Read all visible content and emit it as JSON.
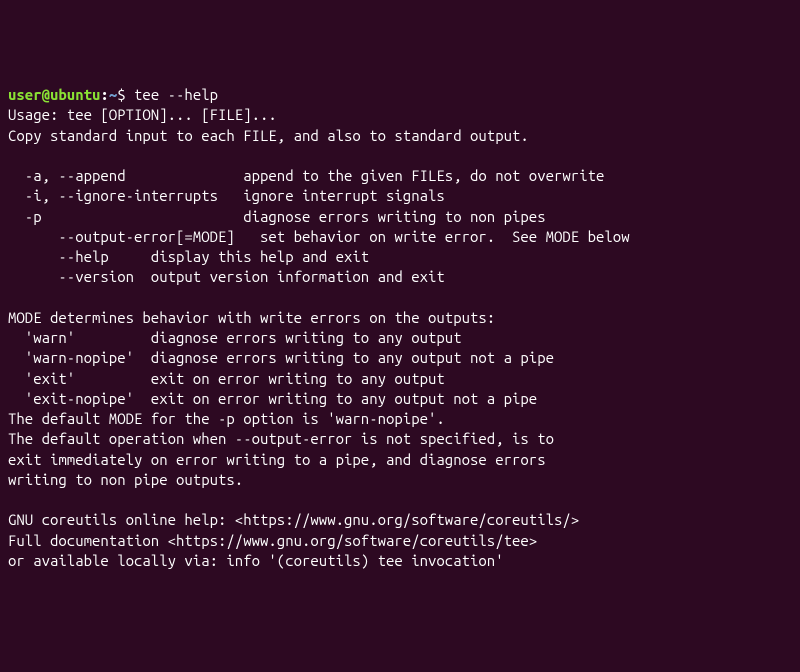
{
  "prompt": {
    "user": "user@ubuntu",
    "colon": ":",
    "tilde": "~",
    "dollar": "$ "
  },
  "command": "tee --help",
  "output": {
    "usage": "Usage: tee [OPTION]... [FILE]...",
    "desc": "Copy standard input to each FILE, and also to standard output.",
    "blank1": "",
    "opt_a": "  -a, --append              append to the given FILEs, do not overwrite",
    "opt_i": "  -i, --ignore-interrupts   ignore interrupt signals",
    "opt_p": "  -p                        diagnose errors writing to non pipes",
    "opt_output_error": "      --output-error[=MODE]   set behavior on write error.  See MODE below",
    "opt_help": "      --help     display this help and exit",
    "opt_version": "      --version  output version information and exit",
    "blank2": "",
    "mode_header": "MODE determines behavior with write errors on the outputs:",
    "mode_warn": "  'warn'         diagnose errors writing to any output",
    "mode_warn_nopipe": "  'warn-nopipe'  diagnose errors writing to any output not a pipe",
    "mode_exit": "  'exit'         exit on error writing to any output",
    "mode_exit_nopipe": "  'exit-nopipe'  exit on error writing to any output not a pipe",
    "default_mode": "The default MODE for the -p option is 'warn-nopipe'.",
    "default_op1": "The default operation when --output-error is not specified, is to",
    "default_op2": "exit immediately on error writing to a pipe, and diagnose errors",
    "default_op3": "writing to non pipe outputs.",
    "blank3": "",
    "help_url": "GNU coreutils online help: <https://www.gnu.org/software/coreutils/>",
    "doc_url": "Full documentation <https://www.gnu.org/software/coreutils/tee>",
    "local_info": "or available locally via: info '(coreutils) tee invocation'"
  }
}
